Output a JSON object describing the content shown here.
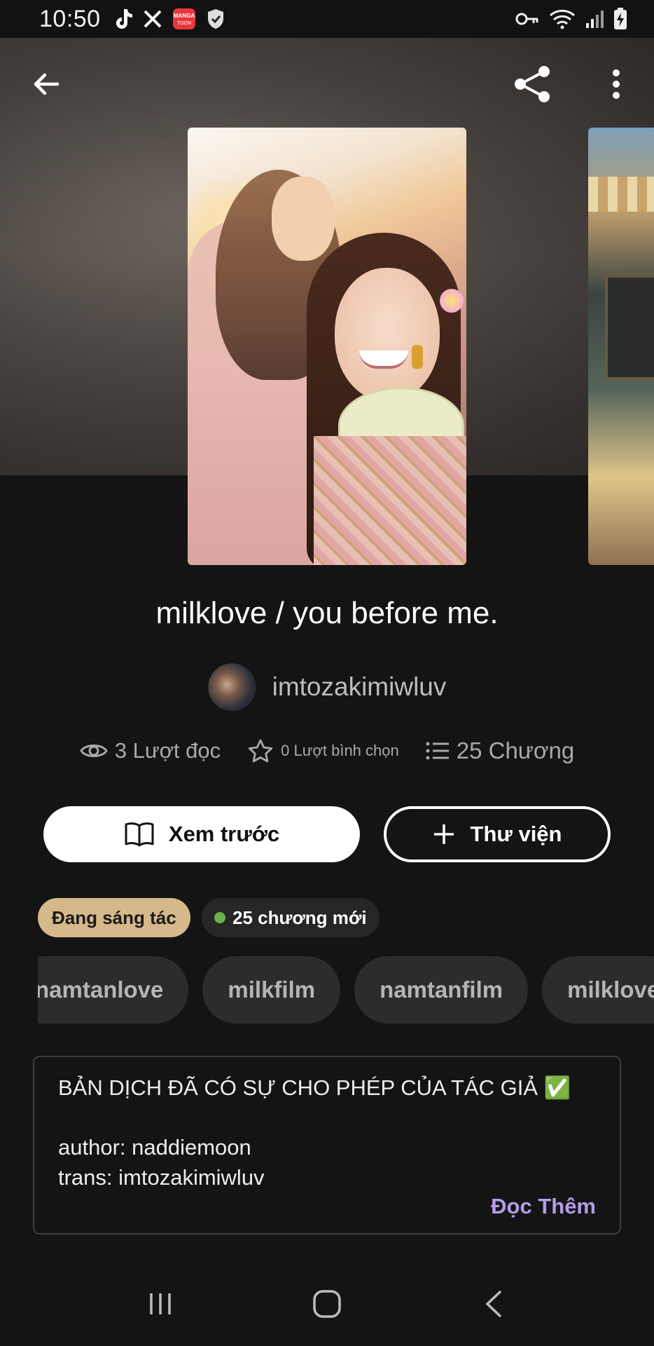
{
  "status_bar": {
    "time": "10:50",
    "left_icons": [
      "tiktok-icon",
      "x-icon",
      "mangatoon-icon",
      "shield-icon"
    ],
    "mangatoon_label": "MANGA TOON",
    "right_icons": [
      "key-icon",
      "wifi-icon",
      "signal-icon",
      "battery-charging-icon"
    ]
  },
  "topbar": {
    "back_icon": "arrow-left-icon",
    "share_icon": "share-icon",
    "more_icon": "more-vertical-icon"
  },
  "story": {
    "title": "milklove / you before me.",
    "author": "imtozakimiwluv",
    "reads": "3 Lượt đọc",
    "votes": "0 Lượt bình chọn",
    "chapters": "25 Chương"
  },
  "actions": {
    "preview_label": "Xem trước",
    "library_label": "Thư viện"
  },
  "badges": {
    "status": "Đang sáng tác",
    "new_chapters": "25 chương mới",
    "new_dot_color": "#6ab04c",
    "status_color": "#d6b98a"
  },
  "tags": [
    "namtanlove",
    "milkfilm",
    "namtanfilm",
    "milklove"
  ],
  "description": {
    "line1": "BẢN DỊCH ĐÃ CÓ SỰ CHO PHÉP CỦA TÁC GIẢ ✅",
    "line2": "author: naddiemoon",
    "line3": "trans: imtozakimiwluv",
    "read_more": "Đọc Thêm",
    "read_more_color": "#b59be8"
  },
  "nav": [
    "recent-apps-icon",
    "home-icon",
    "back-icon"
  ]
}
